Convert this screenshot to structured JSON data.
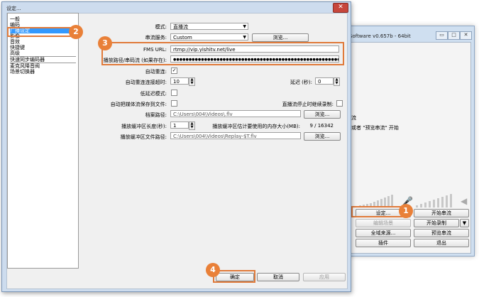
{
  "main_window": {
    "title": "Software v0.657b - 64bit",
    "text1": "流",
    "text2": "或者 \"预览串流\" 开始",
    "buttons": {
      "settings": "设定...",
      "start_stream": "开始串流",
      "edit_scene": "编辑场景",
      "start_record": "开始录制",
      "global_sources": "全域来源...",
      "preview_stream": "预览串流",
      "plugins": "插件",
      "exit": "退出"
    }
  },
  "dialog": {
    "title": "设定...",
    "nav": [
      "一般",
      "编码",
      "广播设定",
      "影像",
      "音效",
      "快捷键",
      "高级",
      "快速同步编码器",
      "麦克风降音阀",
      "场景切换器"
    ],
    "selected_nav": "广播设定",
    "mode_label": "模式:",
    "mode_value": "直播流",
    "service_label": "串流服务:",
    "service_value": "Custom",
    "browse_label": "浏览...",
    "fms_label": "FMS URL:",
    "fms_value": "rtmp://vip.yishitv.net/live",
    "key_label": "播放路径/串码流 (如果存在):",
    "key_value": "●●●●●●●●●●●●●●●●●●●●●●●●●●●●●●●●●●●●●●●●●●●●●●●●●●●●●●●●●●●●●●●●●●●●●●●●●●●●●●●●●●●●●●",
    "auto_reconnect_label": "自动重连:",
    "reconnect_timeout_label": "自动重连连接超时:",
    "reconnect_timeout_value": "10",
    "delay_label": "延迟 (秒):",
    "delay_value": "0",
    "low_latency_label": "低延迟模式:",
    "auto_save_label": "自动把媒体流保存到文件:",
    "stop_record_label": "直播流停止时继续录制:",
    "file_path_label": "档案路径:",
    "file_path_value": "C:\\Users\\004\\Videos\\.flv",
    "buffer_len_label": "播放缓冲区长度(秒):",
    "buffer_len_value": "1",
    "mem_label": "播放缓冲区估计要使用的内存大小(MB):",
    "mem_value": "9 / 16342",
    "buffer_path_label": "播放缓冲区文件路径:",
    "buffer_path_value": "C:\\Users\\004\\Videos\\Replay-$T.flv",
    "ok": "确定",
    "cancel": "取消",
    "apply": "应用"
  },
  "badges": [
    "1",
    "2",
    "3",
    "4"
  ],
  "colors": {
    "highlight": "#e07a3a",
    "badge": "#e98038",
    "nav_selected": "#3399ff"
  }
}
